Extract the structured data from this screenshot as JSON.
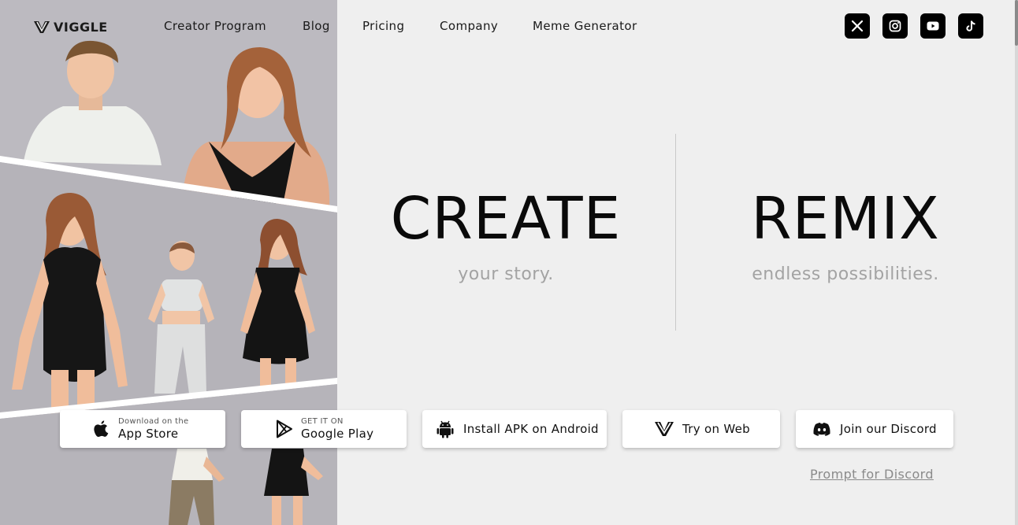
{
  "brand": {
    "name": "VIGGLE"
  },
  "nav": {
    "items": [
      {
        "label": "Creator Program"
      },
      {
        "label": "Blog"
      },
      {
        "label": "Pricing"
      },
      {
        "label": "Company"
      },
      {
        "label": "Meme Generator"
      }
    ]
  },
  "social": {
    "icons": [
      "x-icon",
      "instagram-icon",
      "youtube-icon",
      "tiktok-icon"
    ]
  },
  "hero": {
    "create": {
      "title": "CREATE",
      "subtitle": "your story."
    },
    "remix": {
      "title": "REMIX",
      "subtitle": "endless possibilities."
    }
  },
  "downloads": {
    "app_store": {
      "small": "Download on the",
      "big": "App Store"
    },
    "google_play": {
      "small": "GET IT ON",
      "big": "Google Play"
    },
    "apk": {
      "label": "Install APK on Android"
    },
    "web": {
      "label": "Try on Web"
    },
    "discord": {
      "label": "Join our Discord"
    }
  },
  "prompt_link": {
    "label": "Prompt for Discord"
  },
  "colors": {
    "page_bg": "#efefef",
    "collage_bg": "#b7b5bb",
    "subtitle": "#a3a3a3",
    "link": "#8a8a8a"
  }
}
